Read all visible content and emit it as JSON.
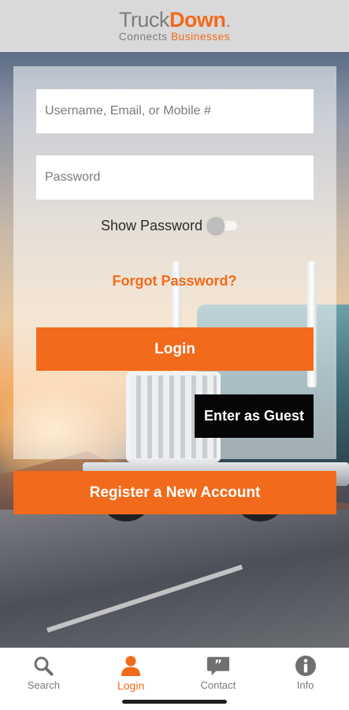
{
  "header": {
    "logo_truck": "Truck",
    "logo_down": "Down",
    "logo_dot": ".",
    "logo_connects": "Connects",
    "logo_businesses": "Businesses"
  },
  "login_form": {
    "username_placeholder": "Username, Email, or Mobile #",
    "username_value": "",
    "password_placeholder": "Password",
    "password_value": "",
    "show_password_label": "Show Password",
    "show_password_on": false,
    "forgot_password": "Forgot Password?",
    "login_button": "Login",
    "guest_button": "Enter as Guest",
    "register_button": "Register a New Account"
  },
  "bottom_nav": {
    "items": [
      {
        "label": "Search",
        "icon": "search-icon",
        "active": false
      },
      {
        "label": "Login",
        "icon": "person-icon",
        "active": true
      },
      {
        "label": "Contact",
        "icon": "chat-bubble-icon",
        "active": false
      },
      {
        "label": "Info",
        "icon": "info-icon",
        "active": false
      }
    ]
  },
  "colors": {
    "brand_orange": "#f26a1b",
    "brand_gray": "#7d7d7d",
    "guest_button": "#060606",
    "nav_inactive": "#7a7a7a"
  }
}
